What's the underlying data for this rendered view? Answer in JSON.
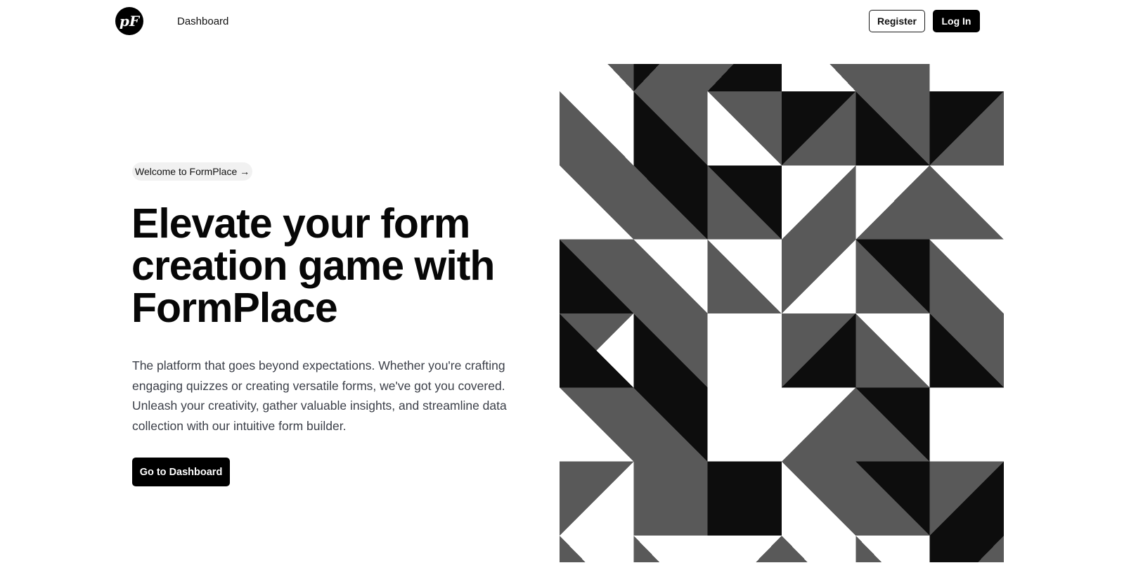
{
  "header": {
    "logo_text": "pF",
    "nav_dashboard": "Dashboard",
    "register_label": "Register",
    "login_label": "Log In"
  },
  "hero": {
    "welcome_label": "Welcome to FormPlace →",
    "title": "Elevate your form creation game with FormPlace",
    "description": "The platform that goes beyond expectations. Whether you're crafting engaging quizzes or creating versatile forms, we've got you covered. Unleash your creativity, gather valuable insights, and streamline data collection with our intuitive form builder.",
    "cta_label": "Go to Dashboard"
  },
  "colors": {
    "dark": "#0d0d0d",
    "gray": "#595959",
    "white": "#ffffff",
    "text_muted": "#3b3f48"
  }
}
